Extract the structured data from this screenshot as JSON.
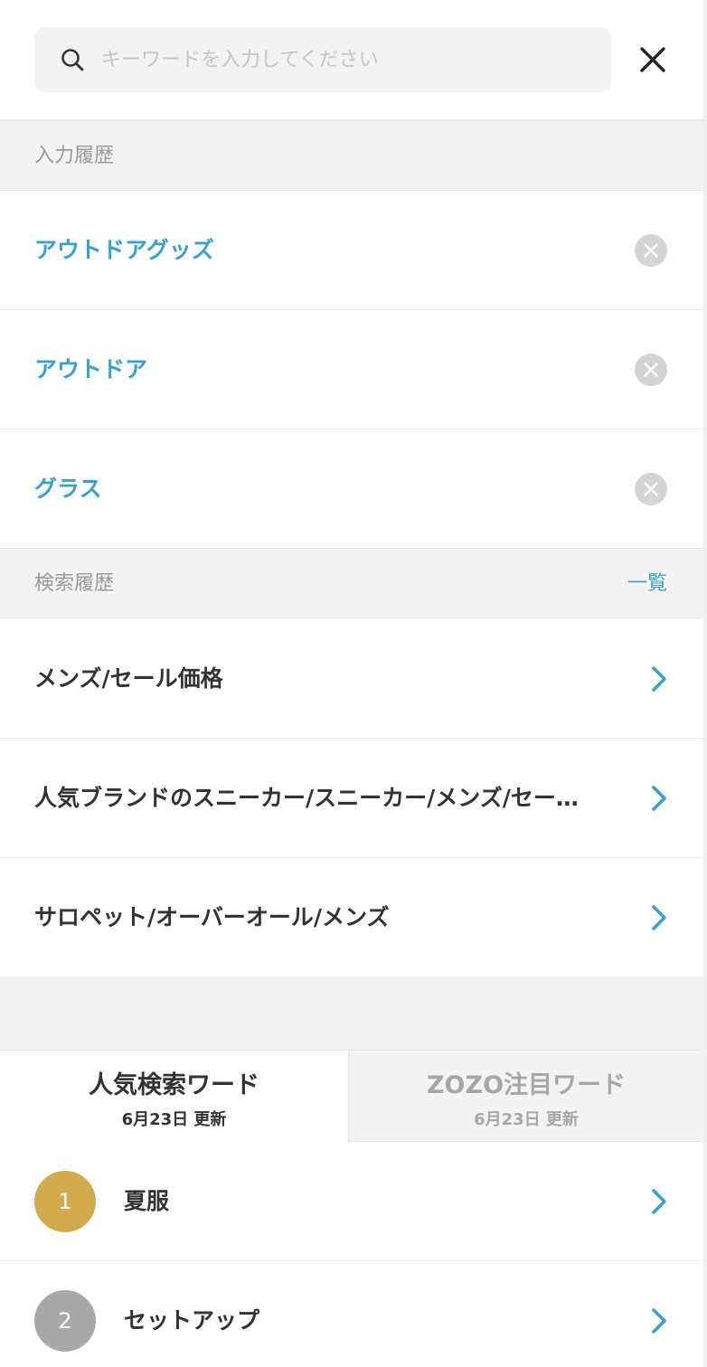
{
  "search": {
    "placeholder": "キーワードを入力してください"
  },
  "input_history": {
    "title": "入力履歴",
    "items": [
      {
        "label": "アウトドアグッズ"
      },
      {
        "label": "アウトドア"
      },
      {
        "label": "グラス"
      }
    ]
  },
  "search_history": {
    "title": "検索履歴",
    "link": "一覧",
    "items": [
      {
        "label": "メンズ/セール価格"
      },
      {
        "label": "人気ブランドのスニーカー/スニーカー/メンズ/セー…"
      },
      {
        "label": "サロペット/オーバーオール/メンズ"
      }
    ]
  },
  "tabs": [
    {
      "title": "人気検索ワード",
      "date": "6月23日 更新",
      "active": true
    },
    {
      "title": "ZOZO注目ワード",
      "date": "6月23日 更新",
      "active": false
    }
  ],
  "ranking": [
    {
      "rank": "1",
      "word": "夏服",
      "color": "#d1ab4e"
    },
    {
      "rank": "2",
      "word": "セットアップ",
      "color": "#a8a8a8"
    }
  ],
  "colors": {
    "accent": "#3aa1cc",
    "gold": "#d1ab4e",
    "silver": "#a8a8a8"
  }
}
